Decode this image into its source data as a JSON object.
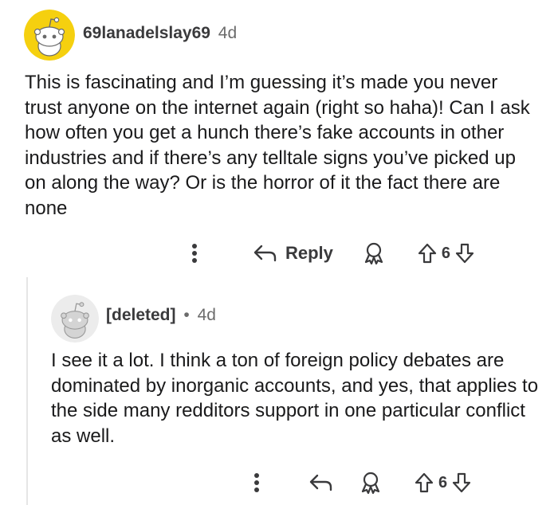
{
  "comment1": {
    "username": "69lanadelslay69",
    "age": "4d",
    "body": "This is fascinating and I’m guessing it’s made you never trust anyone on the internet again (right so haha)! Can I ask how often you get a hunch there’s fake accounts in other industries and if there’s any telltale signs you’ve picked up on along the way? Or is the horror of it the fact there are none",
    "reply_label": "Reply",
    "votes": "6",
    "avatar_color": "#f5d00f"
  },
  "comment2": {
    "username": "[deleted]",
    "separator": "•",
    "age": "4d",
    "body": "I see it a lot. I think a ton of foreign policy debates are dominated by inorganic accounts, and yes, that applies to the side many redditors support in one particular conflict as well.",
    "votes": "6",
    "avatar_color": "#e6e6e6"
  },
  "icons": [
    "more-vertical-icon",
    "reply-arrow-icon",
    "award-icon",
    "upvote-icon",
    "downvote-icon",
    "snoo-avatar-icon"
  ]
}
